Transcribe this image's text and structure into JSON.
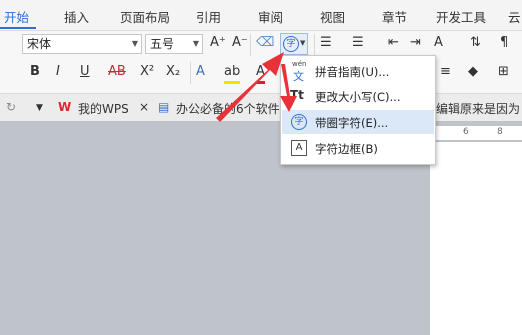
{
  "tabs": [
    "开始",
    "插入",
    "页面布局",
    "引用",
    "审阅",
    "视图",
    "章节",
    "开发工具",
    "云"
  ],
  "font": {
    "family": "宋体",
    "size": "五号"
  },
  "toolbar": {
    "grow_font": "A⁺",
    "shrink_font": "A⁻",
    "bold": "B",
    "italic": "I",
    "underline": "U",
    "strike": "AB",
    "superscript": "X²",
    "subscript": "X₂",
    "phonetic_glyph": "wén\n文",
    "enclose_char": "字"
  },
  "quickbar": {
    "tab1": "我的WPS",
    "tab2": "办公必备的6个软件",
    "tab3": "能编辑原来是因为"
  },
  "ruler": {
    "mark1": "6",
    "mark2": "8"
  },
  "menu": {
    "items": [
      {
        "label": "拼音指南(U)...",
        "icon": "pinyin-guide-icon",
        "glyph": "文"
      },
      {
        "label": "更改大小写(C)...",
        "icon": "change-case-icon",
        "glyph": "Tt"
      },
      {
        "label": "带圈字符(E)...",
        "icon": "enclosed-character-icon",
        "glyph": "字"
      },
      {
        "label": "字符边框(B)",
        "icon": "character-border-icon",
        "glyph": "A"
      }
    ],
    "highlighted_index": 2
  },
  "colors": {
    "accent": "#2e6fd6",
    "arrow": "#e8323a",
    "highlight": "#dbe8f8",
    "doc_bg": "#bfc3ca"
  }
}
